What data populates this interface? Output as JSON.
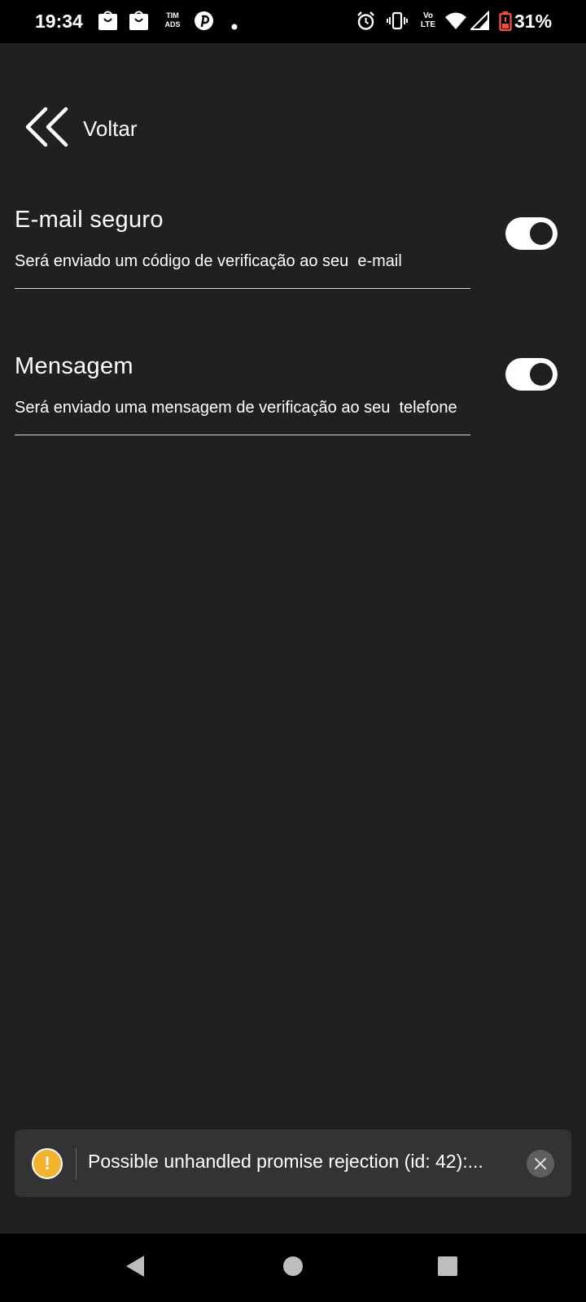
{
  "status_bar": {
    "time": "19:34",
    "notification_icons": [
      "shopee-bag-icon",
      "shopee-bag-icon",
      "tim-ads-icon",
      "pinterest-icon",
      "dot-icon"
    ],
    "tim_ads_label_top": "TIM",
    "tim_ads_label_bottom": "ADS",
    "system_icons": [
      "alarm-icon",
      "vibrate-icon",
      "volte-icon",
      "wifi-icon",
      "signal-icon",
      "battery-icon"
    ],
    "volte_label_top": "Vo",
    "volte_label_bottom": "LTE",
    "battery_percent": "31%"
  },
  "header": {
    "back_label": "Voltar",
    "back_icon": "double-chevron-left-icon"
  },
  "settings": [
    {
      "title": "E-mail seguro",
      "description": "Será enviado um código de verificação ao seu  e-mail",
      "enabled": true
    },
    {
      "title": "Mensagem",
      "description": "Será enviado uma mensagem de verificação ao seu  telefone",
      "enabled": true
    }
  ],
  "toast": {
    "icon": "warning-icon",
    "icon_glyph": "!",
    "message": "Possible unhandled promise rejection (id: 42):...",
    "close_icon": "close-icon"
  },
  "colors": {
    "background": "#212020",
    "toast_background": "#333333",
    "warning": "#f2b331"
  },
  "nav_bar": {
    "buttons": [
      "back-triangle-icon",
      "home-circle-icon",
      "recents-square-icon"
    ]
  }
}
